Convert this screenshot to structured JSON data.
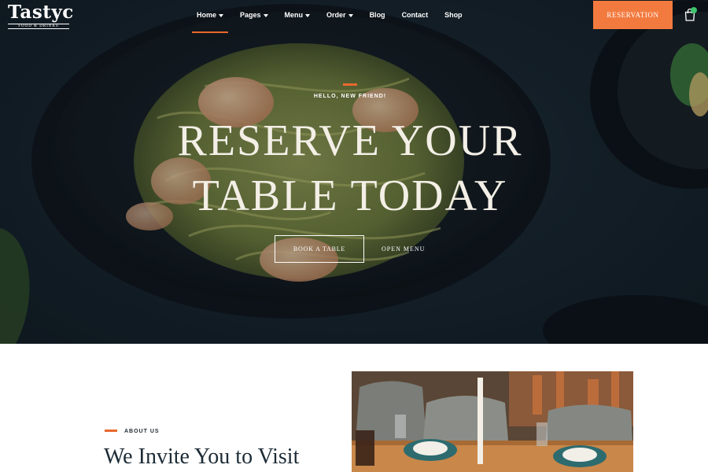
{
  "brand": {
    "name": "Tastyc",
    "tagline": "Food & Drinks"
  },
  "nav": {
    "items": [
      {
        "label": "Home",
        "dropdown": true
      },
      {
        "label": "Pages",
        "dropdown": true
      },
      {
        "label": "Menu",
        "dropdown": true
      },
      {
        "label": "Order",
        "dropdown": true
      },
      {
        "label": "Blog",
        "dropdown": false
      },
      {
        "label": "Contact",
        "dropdown": false
      },
      {
        "label": "Shop",
        "dropdown": false
      }
    ],
    "active": "Home"
  },
  "header": {
    "reservation_label": "RESERVATION",
    "cart_icon": "shopping-bag-icon"
  },
  "hero": {
    "eyebrow": "HELLO, NEW FRIEND!",
    "title_line1": "RESERVE YOUR",
    "title_line2": "TABLE TODAY",
    "primary_button": "BOOK A TABLE",
    "secondary_button": "OPEN MENU"
  },
  "about": {
    "label": "ABOUT US",
    "title": "We Invite You to Visit"
  },
  "colors": {
    "accent": "#f37a3e",
    "accent_line": "#e8682d",
    "hero_bg": "#16222b",
    "heading_dark": "#1c2b36",
    "cart_badge": "#3ec46d"
  }
}
